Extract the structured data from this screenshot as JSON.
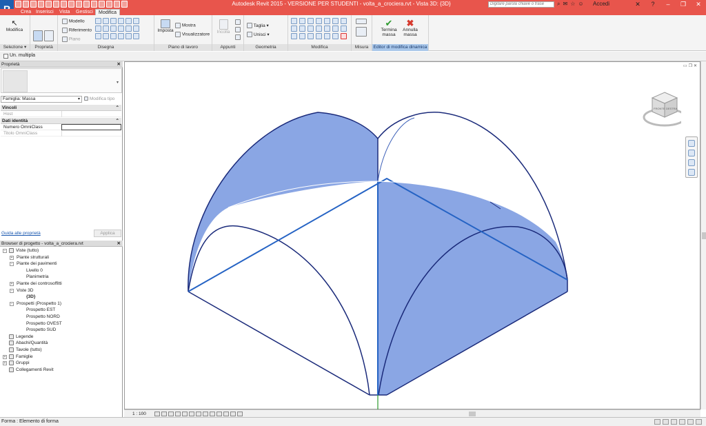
{
  "app": {
    "title": "Autodesk Revit 2015 - VERSIONE PER STUDENTI -     volta_a_crociera.rvt - Vista 3D: {3D}",
    "logo": "R",
    "search_placeholder": "Digitare parola chiave o frase",
    "signin": "Accedi"
  },
  "tabs": [
    "Crea",
    "Inserisci",
    "Vista",
    "Gestisci",
    "Modifica"
  ],
  "active_tab": "Modifica",
  "ribbon": {
    "modifica_label": "Modifica",
    "draw_modello": "Modello",
    "draw_riferimento": "Riferimento",
    "draw_piano": "Piano",
    "imposta": "Imposta",
    "mostra": "Mostra",
    "visualizzatore": "Visualizzatore",
    "incolla": "Incolla",
    "taglia": "Taglia",
    "unisci": "Unisci",
    "termina_massa": [
      "Termina",
      "massa"
    ],
    "annulla_massa": [
      "Annulla",
      "massa"
    ],
    "panels": [
      "Selezione ▾",
      "Proprietà",
      "Disegna",
      "Piano di lavoro",
      "Appunti",
      "Geometria",
      "Modifica",
      "Misura",
      "Editor di modifica dinamica"
    ]
  },
  "options_bar": {
    "multiple_label": "Un. multipla"
  },
  "properties": {
    "title": "Proprietà",
    "family": "Famiglia: Massa",
    "edit_type": "Modifica tipo",
    "sections": [
      {
        "name": "Vincoli",
        "rows": [
          {
            "name": "Host",
            "value": ""
          }
        ]
      },
      {
        "name": "Dati identità",
        "rows": [
          {
            "name": "Numero OmniClass",
            "value": ""
          },
          {
            "name": "Titolo OmniClass",
            "value": ""
          }
        ]
      }
    ],
    "help_link": "Guida alle proprietà",
    "apply": "Applica"
  },
  "browser": {
    "title": "Browser di progetto - volta_a_crociera.rvt",
    "items": [
      {
        "label": "Viste (tutto)",
        "level": 0,
        "toggle": "−",
        "icon": true
      },
      {
        "label": "Piante strutturali",
        "level": 1,
        "toggle": "+"
      },
      {
        "label": "Piante dei pavimenti",
        "level": 1,
        "toggle": "−"
      },
      {
        "label": "Livello 0",
        "level": 2
      },
      {
        "label": "Planimetria",
        "level": 2
      },
      {
        "label": "Piante dei controsoffitti",
        "level": 1,
        "toggle": "+"
      },
      {
        "label": "Viste 3D",
        "level": 1,
        "toggle": "−"
      },
      {
        "label": "{3D}",
        "level": 2,
        "bold": true
      },
      {
        "label": "Prospetti (Prospetto 1)",
        "level": 1,
        "toggle": "−"
      },
      {
        "label": "Prospetto EST",
        "level": 2
      },
      {
        "label": "Prospetto NORD",
        "level": 2
      },
      {
        "label": "Prospetto OVEST",
        "level": 2
      },
      {
        "label": "Prospetto SUD",
        "level": 2
      },
      {
        "label": "Legende",
        "level": 0,
        "icon": true
      },
      {
        "label": "Abachi/Quantità",
        "level": 0,
        "icon": true
      },
      {
        "label": "Tavole (tutto)",
        "level": 0,
        "icon": true
      },
      {
        "label": "Famiglie",
        "level": 0,
        "toggle": "+",
        "icon": true
      },
      {
        "label": "Gruppi",
        "level": 0,
        "toggle": "+",
        "icon": true
      },
      {
        "label": "Collegamenti Revit",
        "level": 0,
        "icon": true
      }
    ]
  },
  "viewbar": {
    "scale": "1 : 100"
  },
  "status": {
    "text": "Forma : Elemento di forma"
  },
  "viewcube": {
    "faces": [
      "FRONTE",
      "DESTRA"
    ]
  },
  "colors": {
    "accent": "#e8554c",
    "mass_fill": "#7a9ae0",
    "edge": "#1a2a7a",
    "selected_edge": "#2563c4"
  }
}
